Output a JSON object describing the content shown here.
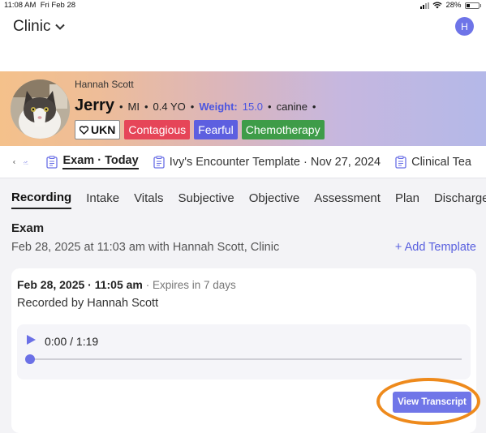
{
  "status_bar": {
    "time": "11:08 AM",
    "date": "Fri Feb 28",
    "battery": "28%"
  },
  "header": {
    "clinic_label": "Clinic",
    "user_initial": "H"
  },
  "patient": {
    "owner": "Hannah Scott",
    "name": "Jerry",
    "sex": "MI",
    "age": "0.4 YO",
    "weight_label": "Weight:",
    "weight_value": "15.0",
    "species": "canine",
    "badges": {
      "ukn": "UKN",
      "contagious": "Contagious",
      "fearful": "Fearful",
      "chemo": "Chemotherapy"
    }
  },
  "encounters": {
    "active": "Exam · Today",
    "template": "Ivy's Encounter Template · Nov 27, 2024",
    "clinical": "Clinical Tea"
  },
  "tabs": [
    "Recording",
    "Intake",
    "Vitals",
    "Subjective",
    "Objective",
    "Assessment",
    "Plan",
    "Discharge"
  ],
  "exam": {
    "title": "Exam",
    "subtitle": "Feb 28, 2025 at 11:03 am with Hannah Scott, Clinic",
    "add_template": "+ Add Template"
  },
  "recording": {
    "timestamp": "Feb 28, 2025 · 11:05 am",
    "expires": "· Expires in 7 days",
    "recorded_by": "Recorded by Hannah Scott",
    "player_time": "0:00 / 1:19",
    "progress": 0,
    "view_transcript": "View Transcript"
  },
  "colors": {
    "accent": "#6b70e6",
    "highlight": "#ee8a1c",
    "contagious": "#e64558",
    "fearful": "#5d5fe0",
    "chemo": "#3e9c48"
  }
}
